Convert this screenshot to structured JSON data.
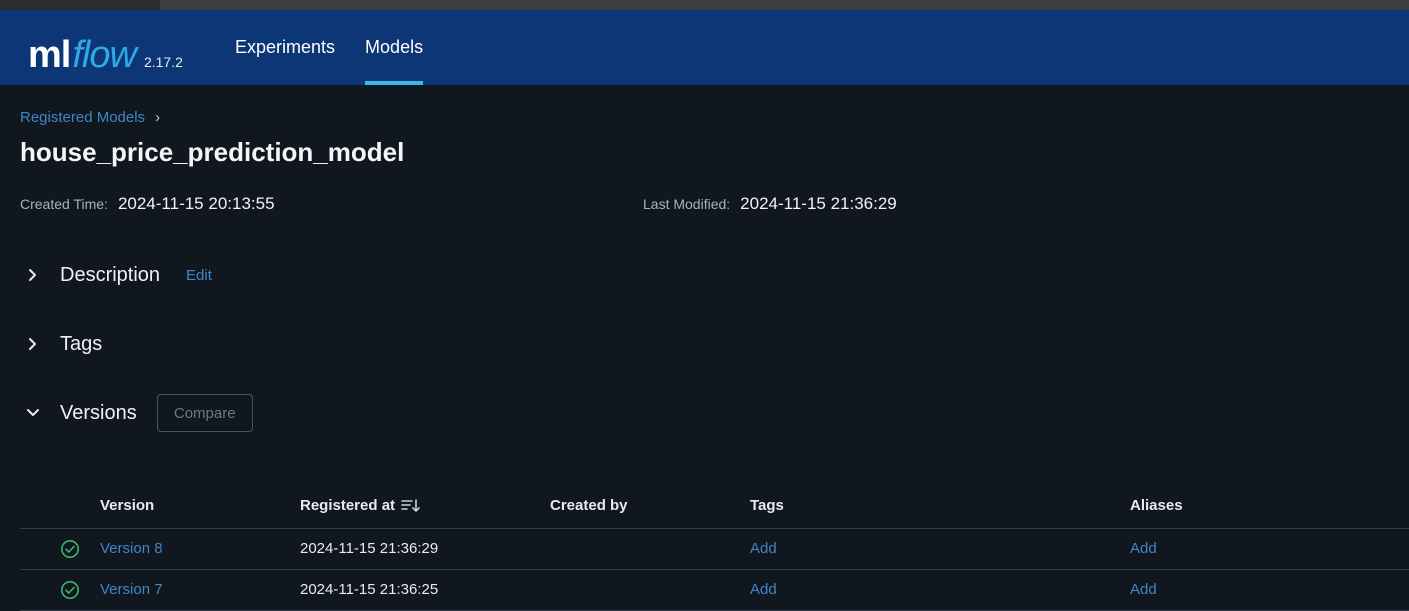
{
  "header": {
    "logo_ml": "ml",
    "logo_flow": "flow",
    "version": "2.17.2",
    "nav": [
      {
        "label": "Experiments",
        "active": false
      },
      {
        "label": "Models",
        "active": true
      }
    ]
  },
  "breadcrumb": {
    "parent": "Registered Models",
    "separator": "›"
  },
  "model": {
    "name": "house_price_prediction_model",
    "created_label": "Created Time:",
    "created_value": "2024-11-15 20:13:55",
    "modified_label": "Last Modified:",
    "modified_value": "2024-11-15 21:36:29"
  },
  "sections": {
    "description": {
      "label": "Description",
      "edit": "Edit",
      "expanded": false
    },
    "tags": {
      "label": "Tags",
      "expanded": false
    },
    "versions": {
      "label": "Versions",
      "compare": "Compare",
      "expanded": true
    }
  },
  "table": {
    "columns": [
      "Version",
      "Registered at",
      "Created by",
      "Tags",
      "Aliases"
    ],
    "rows": [
      {
        "status": "ready",
        "version": "Version 8",
        "registered_at": "2024-11-15 21:36:29",
        "created_by": "",
        "tags": "Add",
        "aliases": "Add"
      },
      {
        "status": "ready",
        "version": "Version 7",
        "registered_at": "2024-11-15 21:36:25",
        "created_by": "",
        "tags": "Add",
        "aliases": "Add"
      }
    ]
  },
  "colors": {
    "header_bg": "#0c3675",
    "page_bg": "#11171f",
    "link": "#3e86c9",
    "active_tab": "#3fb6ea",
    "status_ok": "#3db46d"
  },
  "icons": {
    "collapsed": "chevron-right-icon",
    "expanded": "chevron-down-icon",
    "sort": "sort-icon",
    "status": "check-circle-icon"
  }
}
